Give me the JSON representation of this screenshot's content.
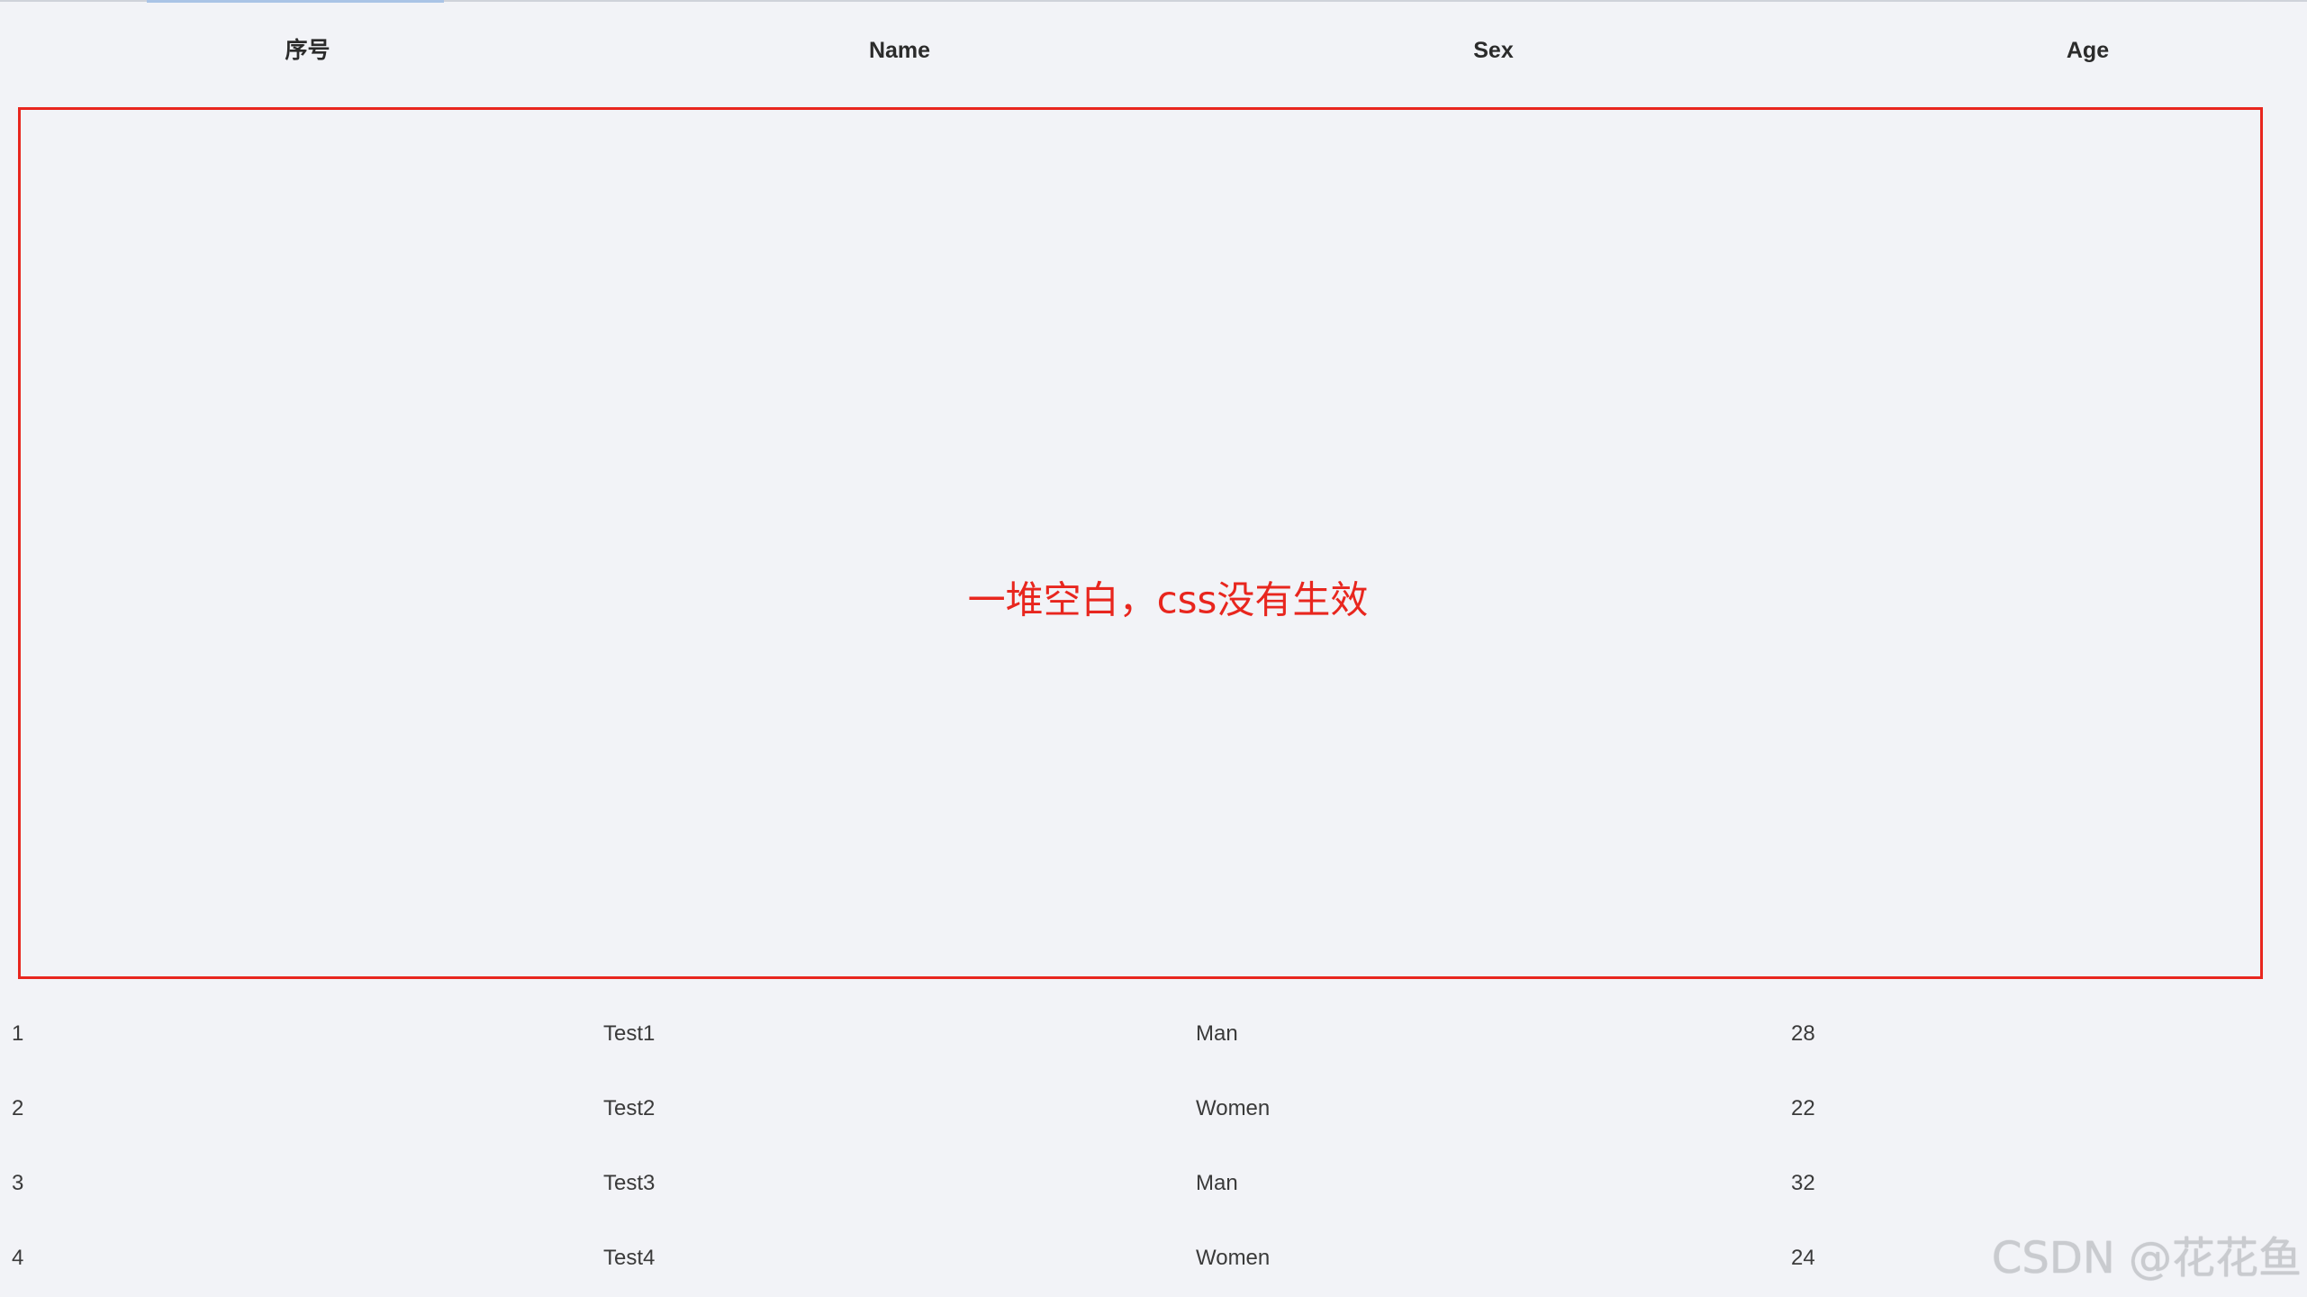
{
  "table": {
    "columns": [
      "序号",
      "Name",
      "Sex",
      "Age"
    ],
    "rows": [
      [
        "1",
        "Test1",
        "Man",
        "28"
      ],
      [
        "2",
        "Test2",
        "Women",
        "22"
      ],
      [
        "3",
        "Test3",
        "Man",
        "32"
      ],
      [
        "4",
        "Test4",
        "Women",
        "24"
      ]
    ]
  },
  "annotation": {
    "text": "一堆空白，css没有生效",
    "color": "#e8261e"
  },
  "watermark": {
    "text": "CSDN @花花鱼"
  },
  "colors": {
    "background": "#f2f3f7",
    "header_text": "#2b2b2b",
    "cell_text": "#3a3a3a",
    "tab_indicator": "#aac4e6"
  }
}
